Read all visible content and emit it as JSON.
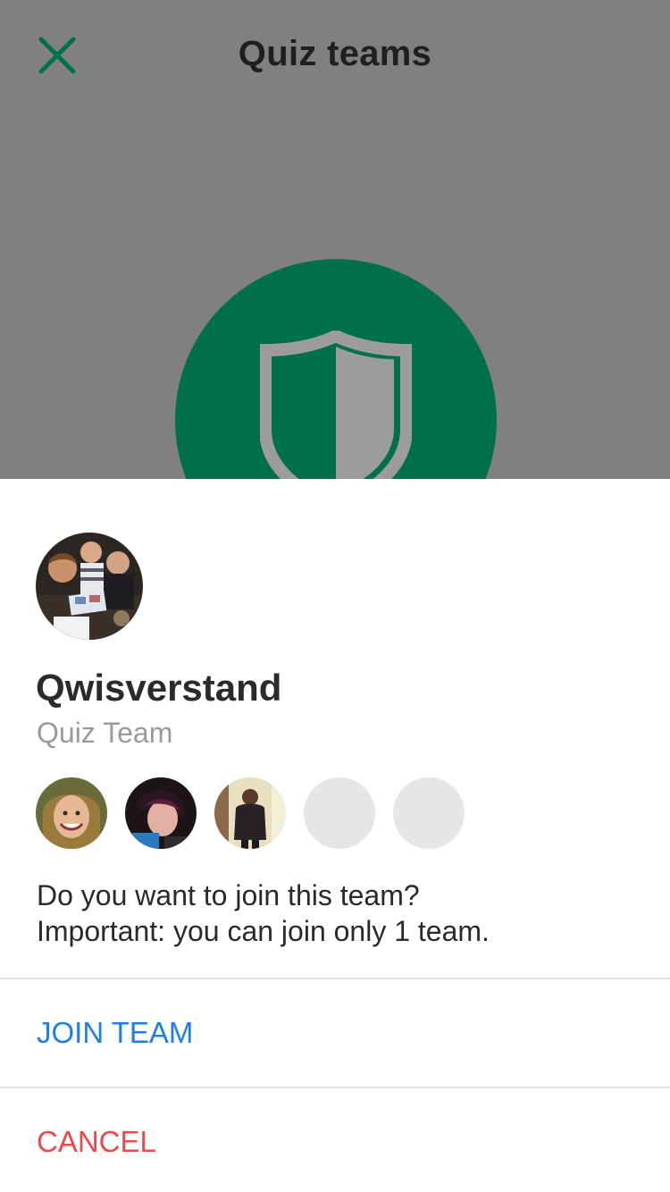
{
  "header": {
    "title": "Quiz teams",
    "close_icon": "close-icon",
    "close_color": "#00704a"
  },
  "hero": {
    "icon": "shield-icon",
    "circle_color": "#00704a"
  },
  "sheet": {
    "team_name": "Qwisverstand",
    "team_type": "Quiz Team",
    "members": [
      {
        "name": "member-1",
        "filled": true
      },
      {
        "name": "member-2",
        "filled": true
      },
      {
        "name": "member-3",
        "filled": true
      },
      {
        "name": "empty-slot-1",
        "filled": false
      },
      {
        "name": "empty-slot-2",
        "filled": false
      }
    ],
    "prompt_line1": "Do you want to join this team?",
    "prompt_line2": "Important: you can join only 1 team.",
    "join_label": "JOIN TEAM",
    "cancel_label": "CANCEL",
    "join_color": "#1e7fe6",
    "cancel_color": "#ec4a4a"
  }
}
